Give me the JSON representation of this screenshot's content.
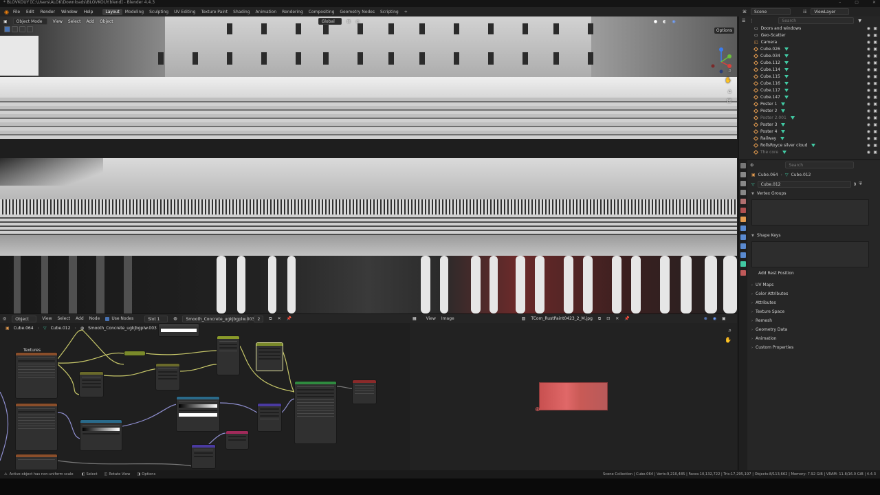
{
  "titlebar": {
    "text": "* BLOVKOUY [C:\\Users\\ALOK\\Downloads\\BLOVKOUY.blend] - Blender 4.4.3"
  },
  "menubar": {
    "items": [
      "File",
      "Edit",
      "Render",
      "Window",
      "Help"
    ],
    "workspaces": [
      "Layout",
      "Modeling",
      "Sculpting",
      "UV Editing",
      "Texture Paint",
      "Shading",
      "Animation",
      "Rendering",
      "Compositing",
      "Geometry Nodes",
      "Scripting"
    ],
    "active_workspace": "Layout",
    "scene": "Scene",
    "view_layer": "ViewLayer"
  },
  "viewport": {
    "mode": "Object Mode",
    "menus": [
      "View",
      "Select",
      "Add",
      "Object"
    ],
    "transform": "Global",
    "options": "Options"
  },
  "node_editor": {
    "editor_type": "Object",
    "menus": [
      "View",
      "Select",
      "Add",
      "Node"
    ],
    "use_nodes_label": "Use Nodes",
    "slot": "Slot 1",
    "material": "Smooth_Concrete_ugkjbgplw.003",
    "users": "2",
    "breadcrumb": {
      "object": "Cube.064",
      "mesh": "Cube.012",
      "material": "Smooth_Concrete_ugkjbgplw.003"
    },
    "frame_label": "Textures"
  },
  "image_editor": {
    "menus": [
      "View",
      "Image"
    ],
    "image_name": "TCom_RustPaint0423_2_M.jpg"
  },
  "outliner": {
    "search_placeholder": "Search",
    "items": [
      {
        "name": "Doors and windows",
        "dim": false,
        "kind": "collection"
      },
      {
        "name": "Geo-Scatter",
        "dim": false,
        "kind": "collection"
      },
      {
        "name": "Camera",
        "dim": false,
        "kind": "camera"
      },
      {
        "name": "Cube.026",
        "dim": false,
        "kind": "mesh"
      },
      {
        "name": "Cube.034",
        "dim": false,
        "kind": "mesh"
      },
      {
        "name": "Cube.112",
        "dim": false,
        "kind": "mesh"
      },
      {
        "name": "Cube.114",
        "dim": false,
        "kind": "mesh"
      },
      {
        "name": "Cube.115",
        "dim": false,
        "kind": "mesh"
      },
      {
        "name": "Cube.116",
        "dim": false,
        "kind": "mesh"
      },
      {
        "name": "Cube.117",
        "dim": false,
        "kind": "mesh"
      },
      {
        "name": "Cube.147",
        "dim": false,
        "kind": "mesh"
      },
      {
        "name": "Poster 1",
        "dim": false,
        "kind": "mesh"
      },
      {
        "name": "Poster 2",
        "dim": false,
        "kind": "mesh"
      },
      {
        "name": "Poster 2.001",
        "dim": true,
        "kind": "mesh"
      },
      {
        "name": "Poster 3",
        "dim": false,
        "kind": "mesh"
      },
      {
        "name": "Poster 4",
        "dim": false,
        "kind": "mesh"
      },
      {
        "name": "Railway",
        "dim": false,
        "kind": "mesh"
      },
      {
        "name": "RollsRoyce silver cloud",
        "dim": false,
        "kind": "mesh"
      },
      {
        "name": "The core",
        "dim": true,
        "kind": "mesh"
      }
    ]
  },
  "properties": {
    "search_placeholder": "Search",
    "object": "Cube.064",
    "mesh": "Cube.012",
    "mesh_field": "Cube.012",
    "users": "9",
    "sections": {
      "vertex_groups": "Vertex Groups",
      "shape_keys": "Shape Keys",
      "add_rest_position": "Add Rest Position",
      "collapsed": [
        "UV Maps",
        "Color Attributes",
        "Attributes",
        "Texture Space",
        "Remesh",
        "Geometry Data",
        "Animation",
        "Custom Properties"
      ]
    }
  },
  "statusbar": {
    "hint": "Active object has non-uniform scale",
    "select": "Select",
    "rotate": "Rotate View",
    "options": "Options",
    "stats": "Scene Collection | Cube.064 | Verts:9,210,485 | Faces:10,132,722 | Tris:17,295,197 | Objects:8/113,662 | Memory: 7.92 GiB | VRAM: 11.8/16.0 GiB | 4.4.3"
  },
  "colors": {
    "accent": "#4772b3",
    "mesh_icon": "#41c9a3",
    "object_icon": "#e39b4f"
  }
}
